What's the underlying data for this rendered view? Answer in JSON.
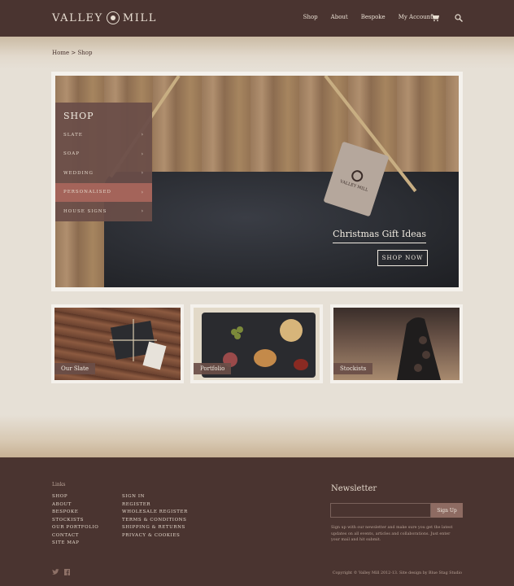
{
  "header": {
    "logo_text_1": "VALLEY",
    "logo_text_2": "MILL",
    "nav": [
      "Shop",
      "About",
      "Bespoke",
      "My Account"
    ]
  },
  "breadcrumb": {
    "home": "Home",
    "separator": " > ",
    "current": "Shop"
  },
  "shop_menu": {
    "title": "SHOP",
    "items": [
      {
        "label": "SLATE",
        "active": false
      },
      {
        "label": "SOAP",
        "active": false
      },
      {
        "label": "WEDDING",
        "active": false
      },
      {
        "label": "PERSONALISED",
        "active": true
      },
      {
        "label": "HOUSE SIGNS",
        "active": false
      }
    ]
  },
  "hero": {
    "tag_brand": "VALLEY MILL",
    "caption": "Christmas Gift Ideas",
    "cta": "SHOP NOW"
  },
  "tiles": [
    {
      "label": "Our Slate"
    },
    {
      "label": "Portfolio"
    },
    {
      "label": "Stockists"
    }
  ],
  "footer": {
    "links_title": "Links",
    "col1": [
      "SHOP",
      "ABOUT",
      "BESPOKE",
      "STOCKISTS",
      "OUR PORTFOLIO",
      "CONTACT",
      "SITE MAP"
    ],
    "col2": [
      "SIGN IN",
      "REGISTER",
      "WHOLESALE REGISTER",
      "TERMS & CONDITIONS",
      "SHIPPING & RETURNS",
      "PRIVACY & COOKIES"
    ],
    "newsletter_title": "Newsletter",
    "newsletter_input_value": "",
    "signup_label": "Sign Up",
    "newsletter_text": "Sign up with our newsletter and make sure you get the latest updates on all events, articles and collaborations. Just enter your mail and hit submit.",
    "copyright": "Copyright © Valley Mill 2012-13. Site design by Blue Stag Studio"
  },
  "colors": {
    "header_bg": "#4a3430",
    "menu_bg": "#6a4e48",
    "menu_active": "#a4645a",
    "accent_button": "#8e6b62"
  }
}
